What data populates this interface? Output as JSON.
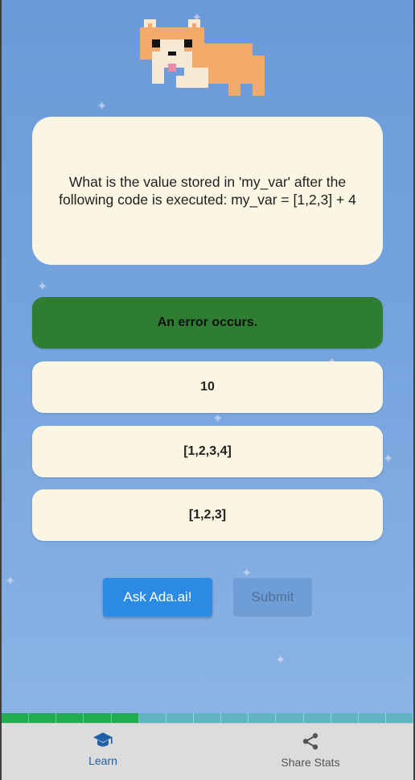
{
  "question": {
    "text": "What is the value stored in 'my_var' after the following code is executed: my_var = [1,2,3] + 4"
  },
  "options": [
    {
      "label": "An error occurs.",
      "selected": true
    },
    {
      "label": "10",
      "selected": false
    },
    {
      "label": "[1,2,3,4]",
      "selected": false
    },
    {
      "label": "[1,2,3]",
      "selected": false
    }
  ],
  "actions": {
    "ask_label": "Ask Ada.ai!",
    "submit_label": "Submit"
  },
  "progress": {
    "completed": 5,
    "total": 15,
    "done_color": "#1fae4f",
    "todo_color": "#5fb3c2"
  },
  "bottom_nav": {
    "learn_label": "Learn",
    "share_label": "Share Stats",
    "learn_icon": "graduation-cap-icon",
    "share_icon": "share-icon"
  },
  "colors": {
    "selected_option": "#2e7d32",
    "card_bg": "#fbf5e3",
    "ask_button": "#2b8ae4",
    "submit_button_disabled": "#6f9ed6",
    "nav_active": "#1f5ea8"
  }
}
